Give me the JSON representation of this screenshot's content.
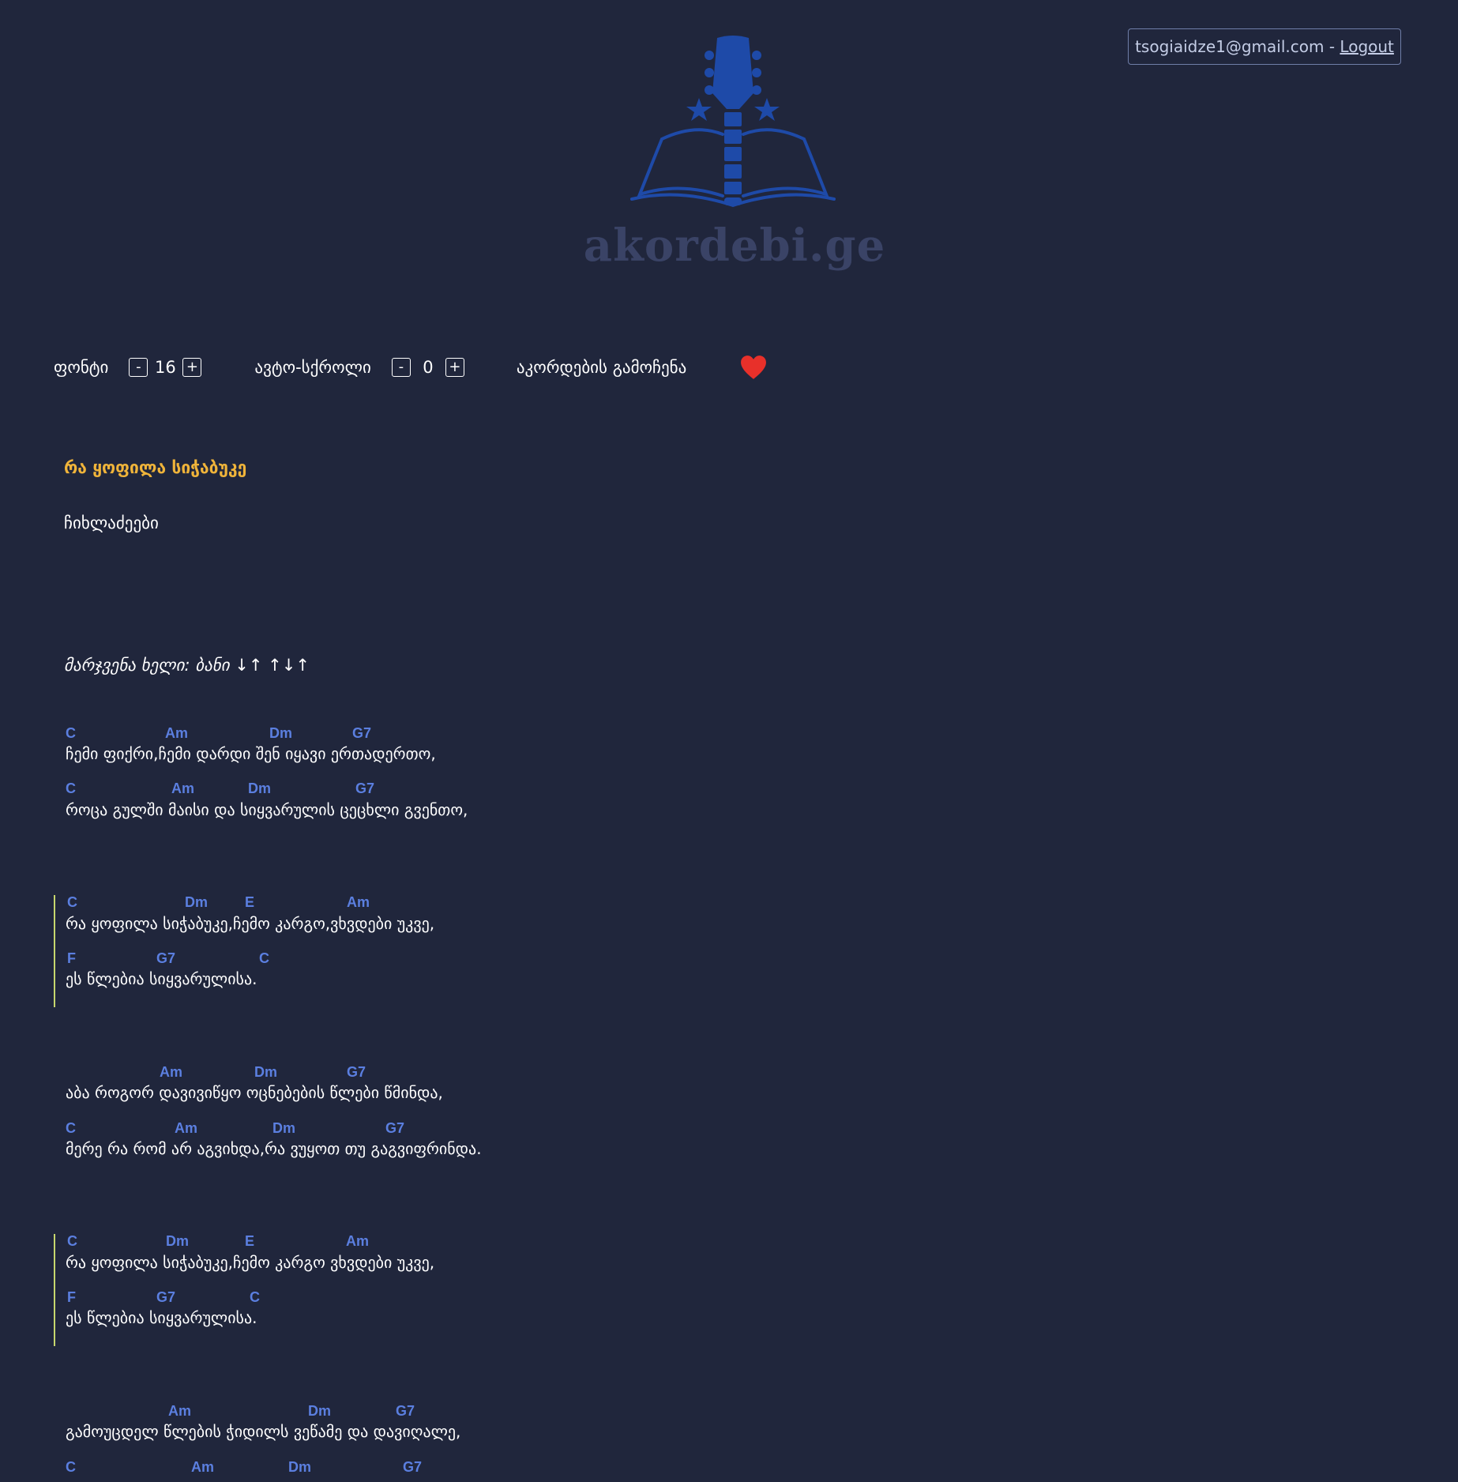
{
  "header": {
    "email": "tsogiaidze1@gmail.com",
    "separator": " - ",
    "logout_label": "Logout",
    "site_name": "akordebi.ge"
  },
  "controls": {
    "font_label": "ფონტი",
    "font_minus": "-",
    "font_value": "16",
    "font_plus": "+",
    "autoscroll_label": "ავტო-სქროლი",
    "autoscroll_minus": "-",
    "autoscroll_value": "0",
    "autoscroll_plus": "+",
    "show_chords_label": "აკორდების გამოჩენა",
    "favorite_icon": "heart-icon"
  },
  "song": {
    "title": "რა ყოფილა სიჭაბუკე",
    "artist": "ჩიხლაძეები",
    "strumming": "მარჯვენა ხელი:  ბანი  ↓↑  ↑↓↑"
  },
  "lines": [
    {
      "chords": [
        "C",
        "Am",
        "Dm",
        "G7"
      ],
      "lyric": "ჩემი ფიქრი,ჩემი დარდი შენ იყავი ერთადერთო,"
    },
    {
      "chords": [
        "C",
        "Am",
        "Dm",
        "G7"
      ],
      "lyric": "როცა გულში მაისი და სიყვარულის ცეცხლი გვენთო,"
    },
    {
      "chords": [
        "C",
        "Dm",
        "E",
        "Am"
      ],
      "lyric": "რა ყოფილა სიჭაბუკე,ჩემო კარგო,ვხვდები უკვე,"
    },
    {
      "chords": [
        "F",
        "G7",
        "C"
      ],
      "lyric": "ეს წლებია სიყვარულისა."
    },
    {
      "chords": [
        "Am",
        "Dm",
        "G7"
      ],
      "lyric": "აბა როგორ დავივიწყო ოცნებების წლები წმინდა,"
    },
    {
      "chords": [
        "C",
        "Am",
        "Dm",
        "G7"
      ],
      "lyric": "მერე რა რომ არ აგვიხდა,რა ვუყოთ თუ გაგვიფრინდა."
    },
    {
      "chords": [
        "C",
        "Dm",
        "E",
        "Am"
      ],
      "lyric": "რა ყოფილა სიჭაბუკე,ჩემო კარგო ვხვდები უკვე,"
    },
    {
      "chords": [
        "F",
        "G7",
        "C"
      ],
      "lyric": "ეს წლებია სიყვარულისა."
    },
    {
      "chords": [
        "Am",
        "Dm",
        "G7"
      ],
      "lyric": "გამოუცდელ წლების ჭიდილს ვეწამე და დავიღალე,"
    },
    {
      "chords": [
        "C",
        "Am",
        "Dm",
        "G7"
      ],
      "lyric": ""
    }
  ],
  "colors": {
    "background": "#20263c",
    "chord": "#5b7fe0",
    "title": "#f0b43a",
    "chorus_bar": "#c7d66d",
    "logo": "#1e4aa8",
    "heart": "#e8302a"
  }
}
